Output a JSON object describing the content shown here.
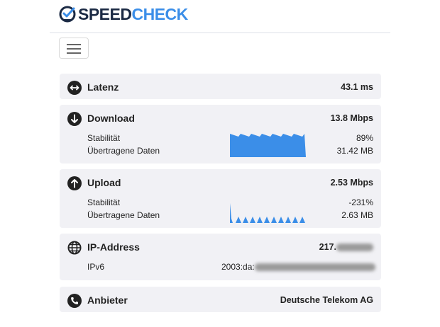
{
  "brand": {
    "part1": "SPEED",
    "part2": "CHECK",
    "accent": "#3b8ee8",
    "dark": "#1b2a44"
  },
  "menu": {
    "icon": "hamburger-icon"
  },
  "latency": {
    "label": "Latenz",
    "value": "43.1 ms",
    "icon": "arrows-horizontal-icon"
  },
  "download": {
    "label": "Download",
    "value": "13.8 Mbps",
    "icon": "arrow-down-circle-icon",
    "stability_label": "Stabilität",
    "stability_value": "89%",
    "data_label": "Übertragene Daten",
    "data_value": "31.42 MB"
  },
  "upload": {
    "label": "Upload",
    "value": "2.53 Mbps",
    "icon": "arrow-up-circle-icon",
    "stability_label": "Stabilität",
    "stability_value": "-231%",
    "data_label": "Übertragene Daten",
    "data_value": "2.63 MB"
  },
  "ip": {
    "label": "IP-Address",
    "ipv4_prefix": "217.",
    "icon": "globe-icon",
    "ipv6_label": "IPv6",
    "ipv6_prefix": "2003:da:"
  },
  "provider": {
    "label": "Anbieter",
    "value": "Deutsche Telekom AG",
    "icon": "phone-icon"
  },
  "colors": {
    "graph": "#3b8ee8",
    "card_bg": "#f1f1f5"
  }
}
